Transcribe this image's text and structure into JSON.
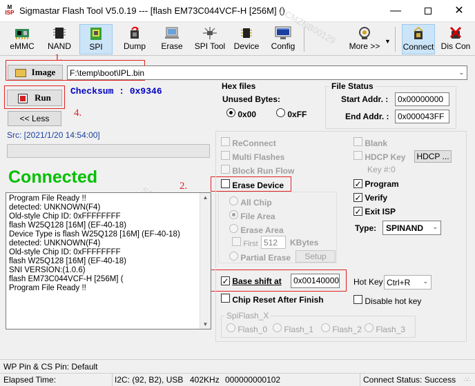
{
  "window": {
    "title": "Sigmastar Flash Tool V5.0.19 --- [flash EM73C044VCF-H [256M] ()",
    "min": "—",
    "close": "✕"
  },
  "toolbar": {
    "emmc": "eMMC",
    "nand": "NAND",
    "spi": "SPI",
    "dump": "Dump",
    "erase": "Erase",
    "spi_tool": "SPI Tool",
    "device": "Device",
    "config": "Config",
    "more": "More >>",
    "connect": "Connect",
    "disconnect": "Dis Con"
  },
  "image": {
    "label": "Image",
    "path": "F:\\temp\\boot\\IPL.bin"
  },
  "run": {
    "label": "Run"
  },
  "less": {
    "label": "<< Less"
  },
  "checksum": "Checksum : 0x9346",
  "src": "Src: [2021/1/20 14:54:00]",
  "progress": 0,
  "connected": "Connected",
  "log": [
    "Program File Ready !!",
    "detected: UNKNOWN(F4)",
    "Old-style Chip ID: 0xFFFFFFFF",
    "flash W25Q128 [16M] (EF-40-18)",
    "Device Type is flash W25Q128 [16M] (EF-40-18)",
    "detected: UNKNOWN(F4)",
    "Old-style Chip ID: 0xFFFFFFFF",
    "flash W25Q128 [16M] (EF-40-18)",
    "SNI VERSION:(1.0.6)",
    "flash EM73C044VCF-H [256M] (",
    "Program File Ready !!"
  ],
  "hex": {
    "title": "Hex files",
    "unused": "Unused Bytes:",
    "opt_00": "0x00",
    "opt_ff": "0xFF"
  },
  "file_status": {
    "title": "File Status",
    "start_label": "Start Addr. :",
    "start_value": "0x00000000",
    "end_label": "End Addr. :",
    "end_value": "0x000043FF"
  },
  "options": {
    "reconnect": "ReConnect",
    "multi_flashes": "Multi Flashes",
    "block_run_flow": "Block Run Flow",
    "erase_device": "Erase Device",
    "all_chip": "All Chip",
    "file_area": "File Area",
    "erase_area": "Erase Area",
    "first": "First",
    "first_value": "512",
    "kbytes": "KBytes",
    "partial_erase": "Partial Erase",
    "setup": "Setup",
    "blank": "Blank",
    "hdcp_key": "HDCP Key",
    "hdcp_btn": "HDCP ...",
    "key_no": "Key #:0",
    "program": "Program",
    "verify": "Verify",
    "exit_isp": "Exit ISP",
    "type_label": "Type:",
    "type_value": "SPINAND",
    "base_shift": "Base shift at",
    "base_shift_value": "0x00140000",
    "hot_key": "Hot Key",
    "hot_key_value": "Ctrl+R",
    "chip_reset": "Chip Reset After Finish",
    "disable_hot_key": "Disable hot key"
  },
  "spiflash": {
    "title": "SpiFlash_X",
    "f0": "Flash_0",
    "f1": "Flash_1",
    "f2": "Flash_2",
    "f3": "Flash_3"
  },
  "annotations": {
    "n1": "1.",
    "n2": "2.",
    "n3": "3.",
    "n4": "4."
  },
  "status": {
    "wp": "WP Pin & CS Pin: Default",
    "elapsed": "Elapsed Time:",
    "i2c": "I2C: (92, B2), USB",
    "speed": "402KHz",
    "counter": "000000000102",
    "connect_status": "Connect Status: Success"
  },
  "watermark": "SCMZNB00129",
  "colors": {
    "connected": "#00c000",
    "checksum": "#0000c0",
    "annotation_red": "#e02020",
    "active_tab": "#cce4f7"
  }
}
